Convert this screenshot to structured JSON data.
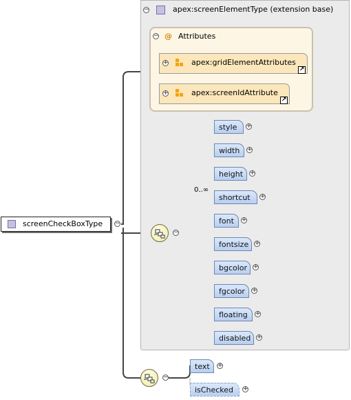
{
  "root": {
    "name": "screenCheckBoxType",
    "icon": "complex-type-icon"
  },
  "extension": {
    "label": "apex:screenElementType (extension base)",
    "toggle": "−"
  },
  "attributes": {
    "symbol": "@",
    "label": "Attributes",
    "toggle": "−",
    "groups": [
      {
        "label": "apex:gridElementAttributes",
        "toggle": "+"
      },
      {
        "label": "apex:screenIdAttribute",
        "toggle": "+"
      }
    ]
  },
  "sequence_1": {
    "toggle": "−",
    "elements": [
      {
        "label": "style",
        "cardinality": ""
      },
      {
        "label": "width",
        "cardinality": ""
      },
      {
        "label": "height",
        "cardinality": ""
      },
      {
        "label": "shortcut",
        "cardinality": "0..∞"
      },
      {
        "label": "font",
        "cardinality": ""
      },
      {
        "label": "fontsize",
        "cardinality": ""
      },
      {
        "label": "bgcolor",
        "cardinality": ""
      },
      {
        "label": "fgcolor",
        "cardinality": ""
      },
      {
        "label": "floating",
        "cardinality": ""
      },
      {
        "label": "disabled",
        "cardinality": ""
      }
    ]
  },
  "sequence_2": {
    "toggle": "−",
    "elements": [
      {
        "label": "text"
      },
      {
        "label": "isChecked"
      }
    ]
  },
  "expand_glyph": "+",
  "root_toggle": "−"
}
